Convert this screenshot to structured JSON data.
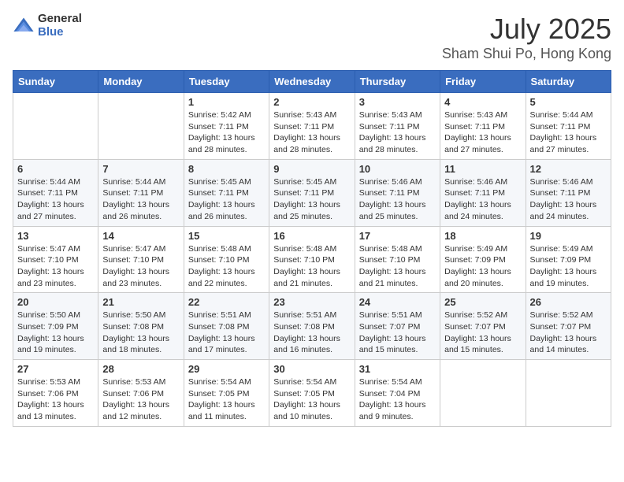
{
  "header": {
    "logo_general": "General",
    "logo_blue": "Blue",
    "month": "July 2025",
    "location": "Sham Shui Po, Hong Kong"
  },
  "weekdays": [
    "Sunday",
    "Monday",
    "Tuesday",
    "Wednesday",
    "Thursday",
    "Friday",
    "Saturday"
  ],
  "weeks": [
    [
      {
        "day": "",
        "sunrise": "",
        "sunset": "",
        "daylight": ""
      },
      {
        "day": "",
        "sunrise": "",
        "sunset": "",
        "daylight": ""
      },
      {
        "day": "1",
        "sunrise": "Sunrise: 5:42 AM",
        "sunset": "Sunset: 7:11 PM",
        "daylight": "Daylight: 13 hours and 28 minutes."
      },
      {
        "day": "2",
        "sunrise": "Sunrise: 5:43 AM",
        "sunset": "Sunset: 7:11 PM",
        "daylight": "Daylight: 13 hours and 28 minutes."
      },
      {
        "day": "3",
        "sunrise": "Sunrise: 5:43 AM",
        "sunset": "Sunset: 7:11 PM",
        "daylight": "Daylight: 13 hours and 28 minutes."
      },
      {
        "day": "4",
        "sunrise": "Sunrise: 5:43 AM",
        "sunset": "Sunset: 7:11 PM",
        "daylight": "Daylight: 13 hours and 27 minutes."
      },
      {
        "day": "5",
        "sunrise": "Sunrise: 5:44 AM",
        "sunset": "Sunset: 7:11 PM",
        "daylight": "Daylight: 13 hours and 27 minutes."
      }
    ],
    [
      {
        "day": "6",
        "sunrise": "Sunrise: 5:44 AM",
        "sunset": "Sunset: 7:11 PM",
        "daylight": "Daylight: 13 hours and 27 minutes."
      },
      {
        "day": "7",
        "sunrise": "Sunrise: 5:44 AM",
        "sunset": "Sunset: 7:11 PM",
        "daylight": "Daylight: 13 hours and 26 minutes."
      },
      {
        "day": "8",
        "sunrise": "Sunrise: 5:45 AM",
        "sunset": "Sunset: 7:11 PM",
        "daylight": "Daylight: 13 hours and 26 minutes."
      },
      {
        "day": "9",
        "sunrise": "Sunrise: 5:45 AM",
        "sunset": "Sunset: 7:11 PM",
        "daylight": "Daylight: 13 hours and 25 minutes."
      },
      {
        "day": "10",
        "sunrise": "Sunrise: 5:46 AM",
        "sunset": "Sunset: 7:11 PM",
        "daylight": "Daylight: 13 hours and 25 minutes."
      },
      {
        "day": "11",
        "sunrise": "Sunrise: 5:46 AM",
        "sunset": "Sunset: 7:11 PM",
        "daylight": "Daylight: 13 hours and 24 minutes."
      },
      {
        "day": "12",
        "sunrise": "Sunrise: 5:46 AM",
        "sunset": "Sunset: 7:11 PM",
        "daylight": "Daylight: 13 hours and 24 minutes."
      }
    ],
    [
      {
        "day": "13",
        "sunrise": "Sunrise: 5:47 AM",
        "sunset": "Sunset: 7:10 PM",
        "daylight": "Daylight: 13 hours and 23 minutes."
      },
      {
        "day": "14",
        "sunrise": "Sunrise: 5:47 AM",
        "sunset": "Sunset: 7:10 PM",
        "daylight": "Daylight: 13 hours and 23 minutes."
      },
      {
        "day": "15",
        "sunrise": "Sunrise: 5:48 AM",
        "sunset": "Sunset: 7:10 PM",
        "daylight": "Daylight: 13 hours and 22 minutes."
      },
      {
        "day": "16",
        "sunrise": "Sunrise: 5:48 AM",
        "sunset": "Sunset: 7:10 PM",
        "daylight": "Daylight: 13 hours and 21 minutes."
      },
      {
        "day": "17",
        "sunrise": "Sunrise: 5:48 AM",
        "sunset": "Sunset: 7:10 PM",
        "daylight": "Daylight: 13 hours and 21 minutes."
      },
      {
        "day": "18",
        "sunrise": "Sunrise: 5:49 AM",
        "sunset": "Sunset: 7:09 PM",
        "daylight": "Daylight: 13 hours and 20 minutes."
      },
      {
        "day": "19",
        "sunrise": "Sunrise: 5:49 AM",
        "sunset": "Sunset: 7:09 PM",
        "daylight": "Daylight: 13 hours and 19 minutes."
      }
    ],
    [
      {
        "day": "20",
        "sunrise": "Sunrise: 5:50 AM",
        "sunset": "Sunset: 7:09 PM",
        "daylight": "Daylight: 13 hours and 19 minutes."
      },
      {
        "day": "21",
        "sunrise": "Sunrise: 5:50 AM",
        "sunset": "Sunset: 7:08 PM",
        "daylight": "Daylight: 13 hours and 18 minutes."
      },
      {
        "day": "22",
        "sunrise": "Sunrise: 5:51 AM",
        "sunset": "Sunset: 7:08 PM",
        "daylight": "Daylight: 13 hours and 17 minutes."
      },
      {
        "day": "23",
        "sunrise": "Sunrise: 5:51 AM",
        "sunset": "Sunset: 7:08 PM",
        "daylight": "Daylight: 13 hours and 16 minutes."
      },
      {
        "day": "24",
        "sunrise": "Sunrise: 5:51 AM",
        "sunset": "Sunset: 7:07 PM",
        "daylight": "Daylight: 13 hours and 15 minutes."
      },
      {
        "day": "25",
        "sunrise": "Sunrise: 5:52 AM",
        "sunset": "Sunset: 7:07 PM",
        "daylight": "Daylight: 13 hours and 15 minutes."
      },
      {
        "day": "26",
        "sunrise": "Sunrise: 5:52 AM",
        "sunset": "Sunset: 7:07 PM",
        "daylight": "Daylight: 13 hours and 14 minutes."
      }
    ],
    [
      {
        "day": "27",
        "sunrise": "Sunrise: 5:53 AM",
        "sunset": "Sunset: 7:06 PM",
        "daylight": "Daylight: 13 hours and 13 minutes."
      },
      {
        "day": "28",
        "sunrise": "Sunrise: 5:53 AM",
        "sunset": "Sunset: 7:06 PM",
        "daylight": "Daylight: 13 hours and 12 minutes."
      },
      {
        "day": "29",
        "sunrise": "Sunrise: 5:54 AM",
        "sunset": "Sunset: 7:05 PM",
        "daylight": "Daylight: 13 hours and 11 minutes."
      },
      {
        "day": "30",
        "sunrise": "Sunrise: 5:54 AM",
        "sunset": "Sunset: 7:05 PM",
        "daylight": "Daylight: 13 hours and 10 minutes."
      },
      {
        "day": "31",
        "sunrise": "Sunrise: 5:54 AM",
        "sunset": "Sunset: 7:04 PM",
        "daylight": "Daylight: 13 hours and 9 minutes."
      },
      {
        "day": "",
        "sunrise": "",
        "sunset": "",
        "daylight": ""
      },
      {
        "day": "",
        "sunrise": "",
        "sunset": "",
        "daylight": ""
      }
    ]
  ]
}
